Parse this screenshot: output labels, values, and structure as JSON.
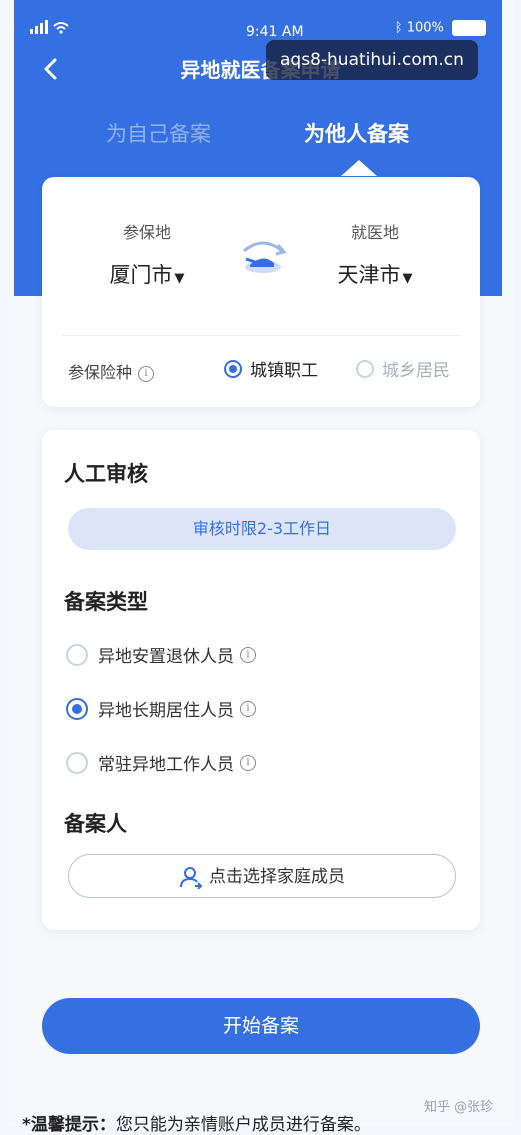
{
  "status_bar": {
    "time": "9:41 AM",
    "battery": "100%"
  },
  "header": {
    "title": "异地就医备案申请",
    "watermark": "aqs8-huatihui.com.cn"
  },
  "tabs": [
    {
      "label": "为自己备案",
      "active": false
    },
    {
      "label": "为他人备案",
      "active": true
    }
  ],
  "locations": {
    "insured_label": "参保地",
    "insured_value": "厦门市",
    "medical_label": "就医地",
    "medical_value": "天津市"
  },
  "insurance": {
    "label": "参保险种",
    "options": [
      {
        "label": "城镇职工",
        "selected": true
      },
      {
        "label": "城乡居民",
        "selected": false
      }
    ]
  },
  "review": {
    "title": "人工审核",
    "note": "审核时限2-3工作日"
  },
  "filing_type": {
    "title": "备案类型",
    "options": [
      {
        "label": "异地安置退休人员",
        "selected": false
      },
      {
        "label": "异地长期居住人员",
        "selected": true
      },
      {
        "label": "常驻异地工作人员",
        "selected": false
      }
    ]
  },
  "filer": {
    "title": "备案人",
    "button_label": "点击选择家庭成员"
  },
  "start_button": "开始备案",
  "tip": {
    "prefix": "*温馨提示：",
    "text": "您只能为亲情账户成员进行备案。"
  },
  "credit": "知乎 @张珍",
  "colors": {
    "primary": "#3570e3",
    "pill_bg": "#dbe5f7"
  },
  "icons": [
    "signal-icon",
    "wifi-icon",
    "bluetooth-icon",
    "battery-icon",
    "back-arrow-icon",
    "swap-icon",
    "info-icon",
    "user-icon",
    "dropdown-caret-icon"
  ]
}
